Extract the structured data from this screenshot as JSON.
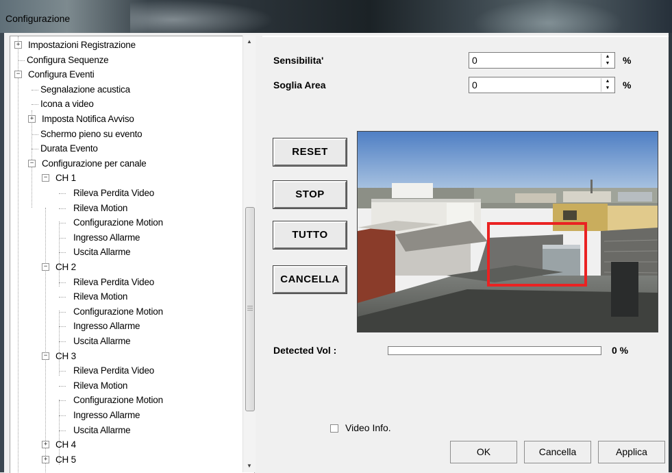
{
  "window": {
    "title": "Configurazione"
  },
  "tree": {
    "items": [
      {
        "label": "Impostazioni Registrazione",
        "level": 0,
        "expander": "+"
      },
      {
        "label": "Configura Sequenze",
        "level": 0,
        "expander": ""
      },
      {
        "label": "Configura Eventi",
        "level": 0,
        "expander": "-"
      },
      {
        "label": "Segnalazione acustica",
        "level": 1,
        "expander": ""
      },
      {
        "label": "Icona a video",
        "level": 1,
        "expander": ""
      },
      {
        "label": "Imposta Notifica Avviso",
        "level": 1,
        "expander": "+"
      },
      {
        "label": "Schermo pieno su evento",
        "level": 1,
        "expander": ""
      },
      {
        "label": "Durata Evento",
        "level": 1,
        "expander": ""
      },
      {
        "label": "Configurazione per canale",
        "level": 1,
        "expander": "-"
      },
      {
        "label": "CH 1",
        "level": 2,
        "expander": "-"
      },
      {
        "label": "Rileva Perdita Video",
        "level": 3,
        "expander": ""
      },
      {
        "label": "Rileva Motion",
        "level": 3,
        "expander": ""
      },
      {
        "label": "Configurazione Motion",
        "level": 3,
        "expander": ""
      },
      {
        "label": "Ingresso Allarme",
        "level": 3,
        "expander": ""
      },
      {
        "label": "Uscita Allarme",
        "level": 3,
        "expander": ""
      },
      {
        "label": "CH 2",
        "level": 2,
        "expander": "-"
      },
      {
        "label": "Rileva Perdita Video",
        "level": 3,
        "expander": ""
      },
      {
        "label": "Rileva Motion",
        "level": 3,
        "expander": ""
      },
      {
        "label": "Configurazione Motion",
        "level": 3,
        "expander": ""
      },
      {
        "label": "Ingresso Allarme",
        "level": 3,
        "expander": ""
      },
      {
        "label": "Uscita Allarme",
        "level": 3,
        "expander": ""
      },
      {
        "label": "CH 3",
        "level": 2,
        "expander": "-"
      },
      {
        "label": "Rileva Perdita Video",
        "level": 3,
        "expander": ""
      },
      {
        "label": "Rileva Motion",
        "level": 3,
        "expander": ""
      },
      {
        "label": "Configurazione Motion",
        "level": 3,
        "expander": ""
      },
      {
        "label": "Ingresso Allarme",
        "level": 3,
        "expander": ""
      },
      {
        "label": "Uscita Allarme",
        "level": 3,
        "expander": ""
      },
      {
        "label": "CH 4",
        "level": 2,
        "expander": "+"
      },
      {
        "label": "CH 5",
        "level": 2,
        "expander": "+"
      }
    ]
  },
  "form": {
    "sensitivity": {
      "label": "Sensibilita'",
      "value": "0",
      "unit": "%"
    },
    "area_threshold": {
      "label": "Soglia Area",
      "value": "0",
      "unit": "%"
    }
  },
  "buttons": {
    "reset": "RESET",
    "stop": "STOP",
    "all": "TUTTO",
    "clear": "CANCELLA"
  },
  "detected": {
    "label": "Detected Vol :",
    "value_text": "0 %",
    "fraction": 0
  },
  "video_info": {
    "label": "Video Info.",
    "checked": false
  },
  "dialog": {
    "ok": "OK",
    "cancel": "Cancella",
    "apply": "Applica"
  },
  "colors": {
    "roi_border": "#ea2222"
  }
}
